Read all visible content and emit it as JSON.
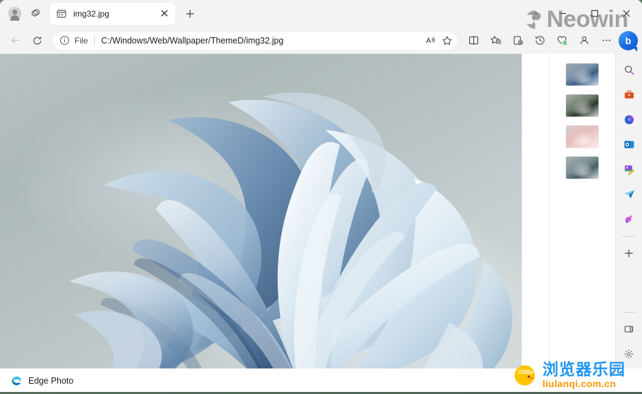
{
  "window": {
    "controls": {
      "minimize_label": "─",
      "maximize_label": "□",
      "close_label": "✕"
    }
  },
  "tabstrip": {
    "profile_label": "",
    "workspaces_label": "",
    "tabs": [
      {
        "title": "img32.jpg",
        "favicon": "photo-icon",
        "close_label": "✕"
      }
    ],
    "new_tab_label": "+"
  },
  "toolbar": {
    "back_label": "←",
    "refresh_label": "↻",
    "address": {
      "info_icon": "info-icon",
      "scheme_label": "File",
      "url": "C:/Windows/Web/Wallpaper/ThemeD/img32.jpg",
      "read_aloud_icon": "read-aloud-icon",
      "favorite_icon": "star-icon"
    },
    "split_screen_icon": "split-screen-icon",
    "favorites_icon": "favorites-list-icon",
    "collections_icon": "collections-icon",
    "history_icon": "history-icon",
    "browser_essentials_icon": "browser-essentials-icon",
    "profile_icon": "profile-icon",
    "settings_more_icon": "more-icon",
    "copilot_icon": "copilot-icon",
    "copilot_label": "b"
  },
  "viewer": {
    "image_alt": "Windows 11 Bloom wallpaper",
    "thumbnails": [
      {
        "name": "thumbnail-1",
        "variant": "blue"
      },
      {
        "name": "thumbnail-2",
        "variant": "green"
      },
      {
        "name": "thumbnail-3",
        "variant": "pink"
      },
      {
        "name": "thumbnail-4",
        "variant": "teal"
      }
    ]
  },
  "statusbar": {
    "app_name": "Edge Photo",
    "app_icon": "edge-logo"
  },
  "sidebar": {
    "items": [
      {
        "name": "sidebar-search",
        "icon": "search-icon",
        "glyph": "🔍"
      },
      {
        "name": "sidebar-tools",
        "icon": "briefcase-icon",
        "glyph": "💼"
      },
      {
        "name": "sidebar-copilot",
        "icon": "copilot-icon",
        "glyph": "◐"
      },
      {
        "name": "sidebar-outlook",
        "icon": "outlook-icon",
        "glyph": "O"
      },
      {
        "name": "sidebar-image-edit",
        "icon": "image-edit-icon",
        "glyph": "🖼"
      },
      {
        "name": "sidebar-telegram",
        "icon": "send-icon",
        "glyph": "➤"
      },
      {
        "name": "sidebar-games",
        "icon": "games-icon",
        "glyph": "🎮"
      }
    ],
    "add_label": "+",
    "customize_icon": "panel-icon",
    "settings_icon": "gear-icon"
  },
  "watermarks": {
    "neowin": "Neowin",
    "liulanqi_cn": "浏览器乐园",
    "liulanqi_domain": "liulanqi.com.cn"
  },
  "colors": {
    "chrome_bg": "#f3f3f3",
    "tab_active": "#ffffff",
    "accent_blue": "#0c5bd0",
    "watermark_blue": "#2196f3",
    "watermark_orange": "#ff9800"
  }
}
